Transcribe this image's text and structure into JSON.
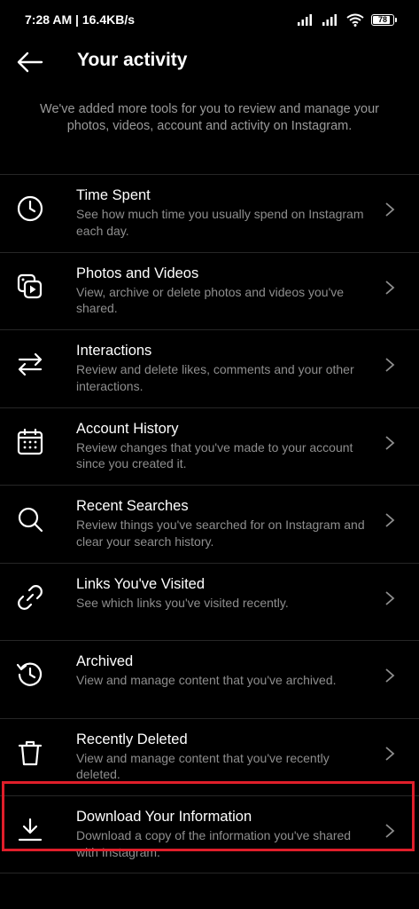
{
  "status_bar": {
    "time_speed": "7:28 AM | 16.4KB/s",
    "battery": "78"
  },
  "header": {
    "title": "Your activity"
  },
  "intro": "We've added more tools for you to review and manage your photos, videos, account and activity on Instagram.",
  "items": [
    {
      "title": "Time Spent",
      "desc": "See how much time you usually spend on Instagram each day.",
      "icon": "clock-icon"
    },
    {
      "title": "Photos and Videos",
      "desc": "View, archive or delete photos and videos you've shared.",
      "icon": "photos-videos-icon"
    },
    {
      "title": "Interactions",
      "desc": "Review and delete likes, comments and your other interactions.",
      "icon": "interactions-arrows-icon"
    },
    {
      "title": "Account History",
      "desc": "Review changes that you've made to your account since you created it.",
      "icon": "calendar-icon"
    },
    {
      "title": "Recent Searches",
      "desc": "Review things you've searched for on Instagram and clear your search history.",
      "icon": "search-icon"
    },
    {
      "title": "Links You've Visited",
      "desc": "See which links you've visited recently.",
      "icon": "link-icon"
    },
    {
      "title": "Archived",
      "desc": "View and manage content that you've archived.",
      "icon": "archive-history-icon"
    },
    {
      "title": "Recently Deleted",
      "desc": "View and manage content that you've recently deleted.",
      "icon": "trash-icon"
    },
    {
      "title": "Download Your Information",
      "desc": "Download a copy of the information you've shared with Instagram.",
      "icon": "download-icon"
    }
  ],
  "colors": {
    "background": "#000000",
    "divider": "#262626",
    "secondary_text": "#8e8e8e",
    "highlight": "#e01e2a"
  }
}
